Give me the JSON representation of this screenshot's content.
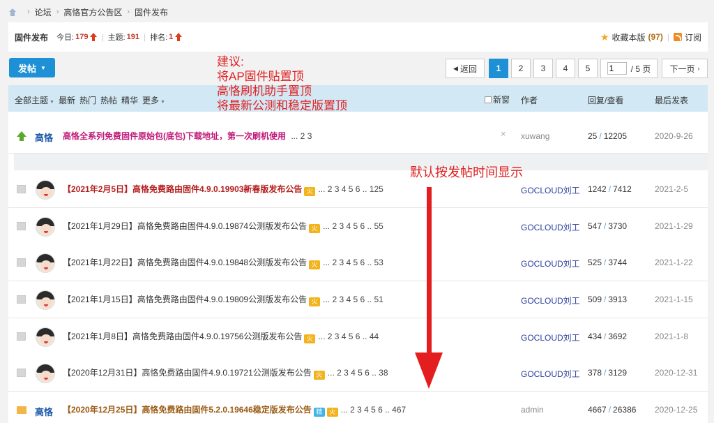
{
  "breadcrumb": [
    "论坛",
    "高恪官方公告区",
    "固件发布"
  ],
  "forum": {
    "name": "固件发布",
    "today_label": "今日:",
    "today": "179",
    "topics_label": "主题:",
    "topics": "191",
    "rank_label": "排名:",
    "rank": "1",
    "fav_label": "收藏本版",
    "fav_count": "(97)",
    "subscribe_label": "订阅"
  },
  "post_button": "发帖",
  "pager": {
    "back": "返回",
    "pages": [
      "1",
      "2",
      "3",
      "4",
      "5"
    ],
    "input": "1",
    "total": "/ 5 页",
    "next": "下一页"
  },
  "annotations": {
    "note_lines": [
      "建议:",
      "将AP固件贴置顶",
      "高恪刷机助手置顶",
      "将最新公测和稳定版置顶"
    ],
    "note2": "默认按发帖时间显示"
  },
  "table_header": {
    "filters": [
      "全部主题",
      "最新",
      "热门",
      "热帖",
      "精华",
      "更多"
    ],
    "new_window": "新窗",
    "author": "作者",
    "replies": "回复/查看",
    "last_post": "最后发表"
  },
  "sticky": {
    "logo": "高恪",
    "title": "高恪全系列免费固件原始包(底包)下载地址，第一次刷机使用",
    "pages": "... 2  3",
    "close": "×",
    "author": "xuwang",
    "replies": "25",
    "views": "12205",
    "last": "2020-9-26"
  },
  "threads": [
    {
      "title": "【2021年2月5日】高恪免费路由固件4.9.0.19903新春版发布公告",
      "style": "red",
      "pages": "... 2  3  4  5  6 .. 125",
      "author": "GOCLOUD刘工",
      "replies": "1242",
      "views": "7412",
      "last": "2021-2-5"
    },
    {
      "title": "【2021年1月29日】高恪免费路由固件4.9.0.19874公测版发布公告",
      "style": "",
      "pages": "... 2  3  4  5  6 .. 55",
      "author": "GOCLOUD刘工",
      "replies": "547",
      "views": "3730",
      "last": "2021-1-29"
    },
    {
      "title": "【2021年1月22日】高恪免费路由固件4.9.0.19848公测版发布公告",
      "style": "",
      "pages": "... 2  3  4  5  6 .. 53",
      "author": "GOCLOUD刘工",
      "replies": "525",
      "views": "3744",
      "last": "2021-1-22"
    },
    {
      "title": "【2021年1月15日】高恪免费路由固件4.9.0.19809公测版发布公告",
      "style": "",
      "pages": "... 2  3  4  5  6 .. 51",
      "author": "GOCLOUD刘工",
      "replies": "509",
      "views": "3913",
      "last": "2021-1-15"
    },
    {
      "title": "【2021年1月8日】高恪免费路由固件4.9.0.19756公测版发布公告",
      "style": "",
      "pages": "... 2  3  4  5  6 .. 44",
      "author": "GOCLOUD刘工",
      "replies": "434",
      "views": "3692",
      "last": "2021-1-8"
    },
    {
      "title": "【2020年12月31日】高恪免费路由固件4.9.0.19721公测版发布公告",
      "style": "",
      "pages": "... 2  3  4  5  6 .. 38",
      "author": "GOCLOUD刘工",
      "replies": "378",
      "views": "3129",
      "last": "2020-12-31"
    },
    {
      "title": "【2020年12月25日】高恪免费路由固件5.2.0.19646稳定版发布公告",
      "style": "brown",
      "pages": "... 2  3  4  5  6 .. 467",
      "author": "admin",
      "replies": "4667",
      "views": "26386",
      "last": "2020-12-25"
    }
  ],
  "badges": {
    "hot": "火",
    "jing": "精"
  },
  "colors": {
    "accent": "#1e90d6",
    "annotation": "#e41e1e",
    "header_bg": "#d2e8f4"
  }
}
